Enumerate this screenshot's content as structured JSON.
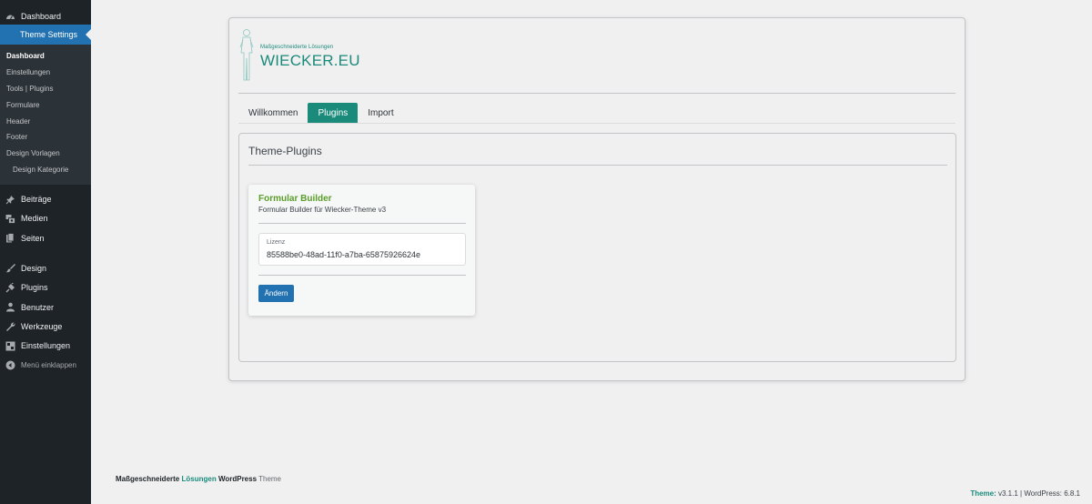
{
  "sidebar": {
    "dashboard": {
      "label": "Dashboard",
      "icon": "dashboard-icon"
    },
    "current": {
      "label": "Theme Settings"
    },
    "submenu": [
      {
        "label": "Dashboard"
      },
      {
        "label": "Einstellungen"
      },
      {
        "label": "Tools | Plugins"
      },
      {
        "label": "Formulare"
      },
      {
        "label": "Header"
      },
      {
        "label": "Footer"
      },
      {
        "label": "Design Vorlagen"
      },
      {
        "label": "Design Kategorie"
      }
    ],
    "group1": [
      {
        "label": "Beiträge",
        "icon": "pin-icon"
      },
      {
        "label": "Medien",
        "icon": "media-icon"
      },
      {
        "label": "Seiten",
        "icon": "pages-icon"
      }
    ],
    "group2": [
      {
        "label": "Design",
        "icon": "brush-icon"
      },
      {
        "label": "Plugins",
        "icon": "plugin-icon"
      },
      {
        "label": "Benutzer",
        "icon": "user-icon"
      },
      {
        "label": "Werkzeuge",
        "icon": "wrench-icon"
      },
      {
        "label": "Einstellungen",
        "icon": "settings-icon"
      }
    ],
    "collapse": {
      "label": "Menü einklappen",
      "icon": "collapse-icon"
    }
  },
  "logo": {
    "tagline": "Maßgeschneiderte Lösungen",
    "wordmark": "WIECKER.EU"
  },
  "tabs": [
    {
      "label": "Willkommen",
      "active": false
    },
    {
      "label": "Plugins",
      "active": true
    },
    {
      "label": "Import",
      "active": false
    }
  ],
  "panel": {
    "title": "Theme-Plugins"
  },
  "plugin": {
    "name": "Formular Builder",
    "description": "Formular Builder für Wiecker-Theme v3",
    "license_label": "Lizenz",
    "license_value": "85588be0-48ad-11f0-a7ba-65875926624e",
    "button_label": "Ändern"
  },
  "footer": {
    "left_part1": "Maßgeschneiderte",
    "left_part2": "Lösungen",
    "left_part3": "WordPress",
    "left_part4": "Theme",
    "right_label": "Theme:",
    "right_theme_version": "v3.1.1",
    "right_separator": "|",
    "right_wp": "WordPress: 6.8.1"
  },
  "colors": {
    "sidebar_bg": "#1d2327",
    "accent_blue": "#2271b1",
    "brand_teal": "#1a8a7a",
    "plugin_green": "#5a9e2a"
  }
}
